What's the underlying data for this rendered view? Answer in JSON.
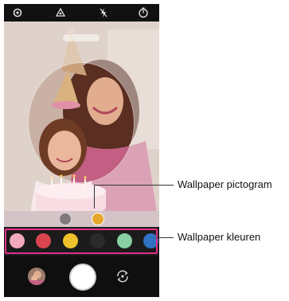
{
  "callouts": {
    "pictogram_label": "Wallpaper pictogram",
    "colors_label": "Wallpaper kleuren"
  },
  "status_icons": [
    "settings-icon",
    "sticker-icon",
    "flash-off-icon",
    "timer-icon"
  ],
  "palette": {
    "colors": [
      "#f2a8bd",
      "#d9454f",
      "#eec12b",
      "#2a2a2a",
      "#86d0a4",
      "#2f72c2"
    ],
    "highlight_color": "#e0308a"
  },
  "wallpaper_buttons": {
    "icons": [
      "wallpaper-off-icon",
      "wallpaper-selected-icon"
    ],
    "selected_color": "#e6a82a"
  }
}
